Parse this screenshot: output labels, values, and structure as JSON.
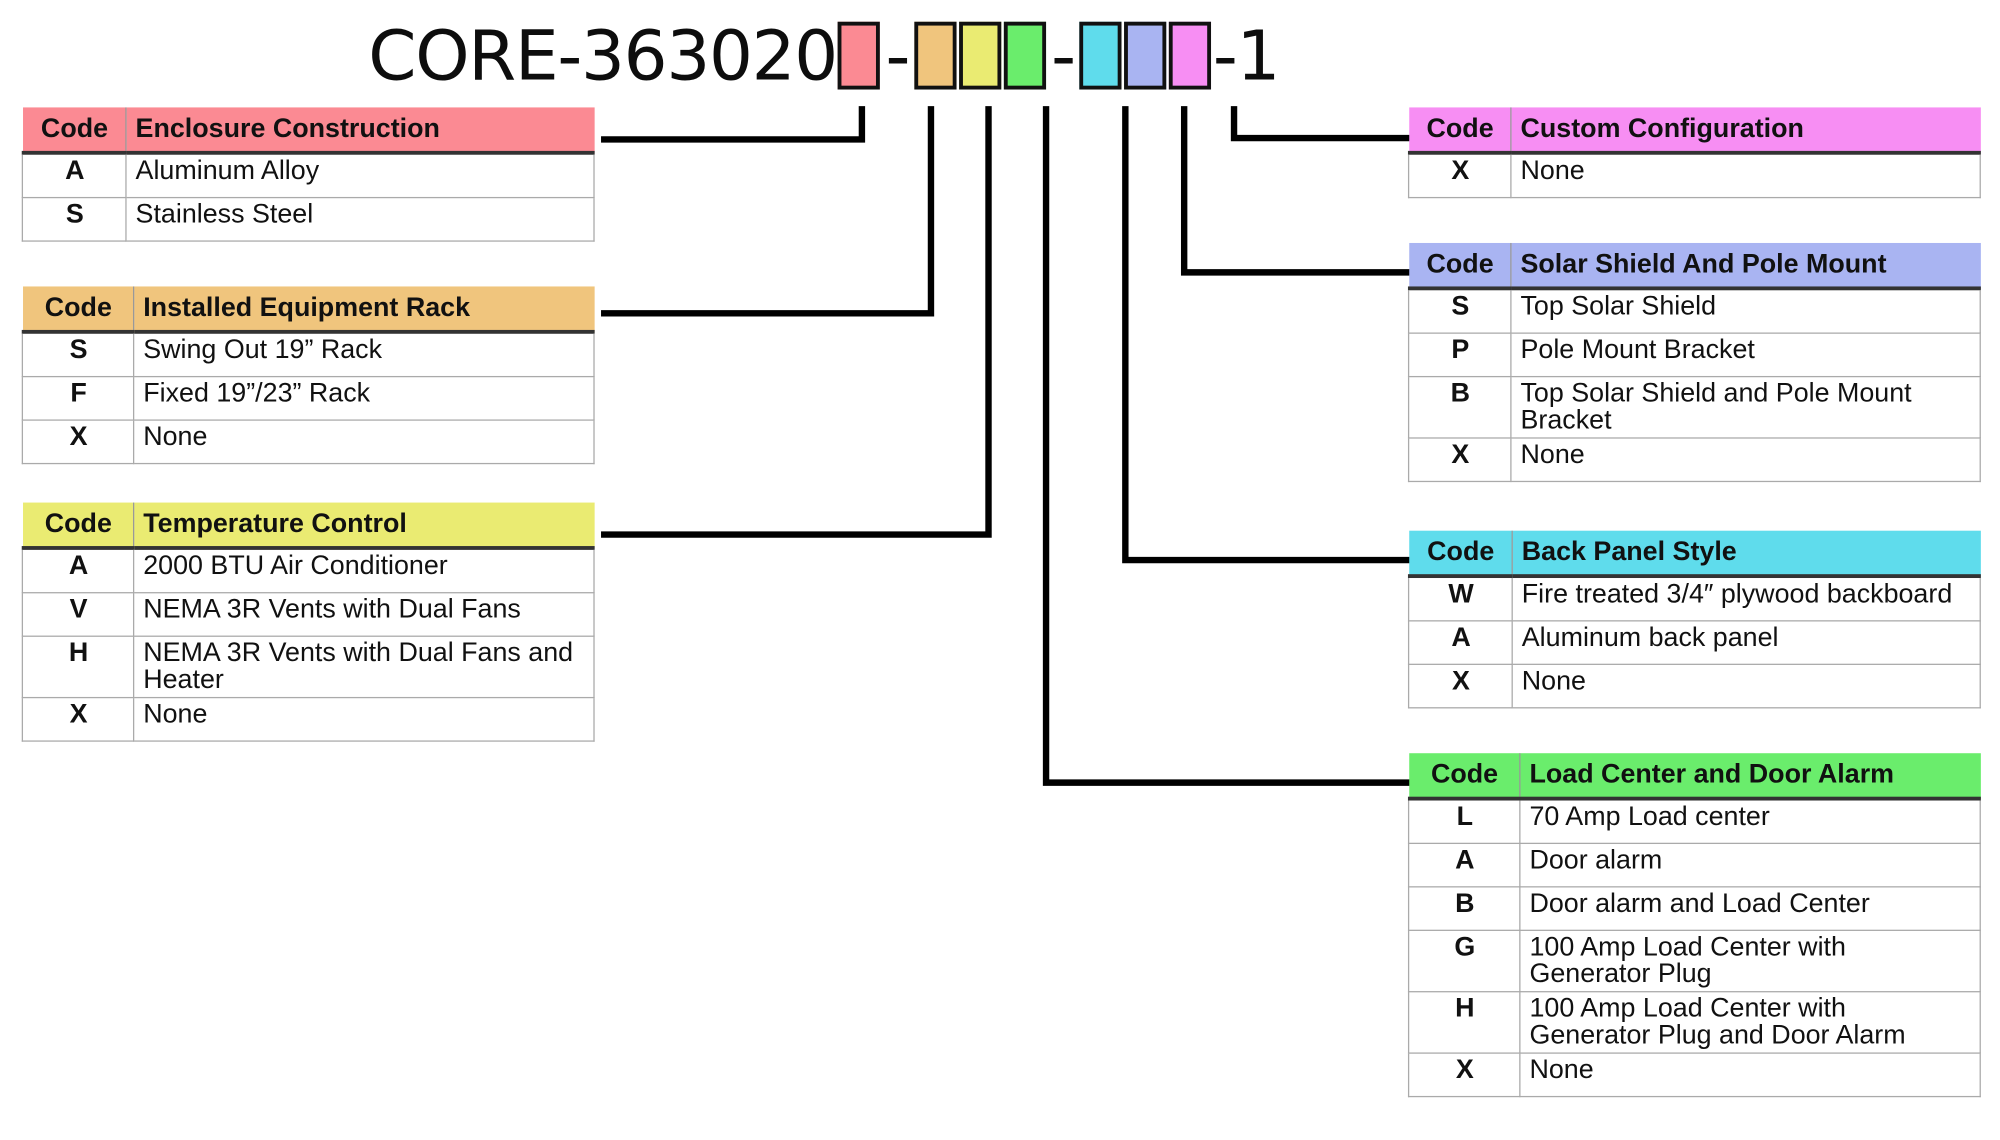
{
  "title": {
    "prefix": "CORE-363020",
    "dash": "-",
    "suffix": "-1"
  },
  "tables": [
    {
      "key": "enclosure",
      "color": "#fb8a93",
      "code_header": "Code",
      "title": "Enclosure Construction",
      "rows": [
        {
          "code": "A",
          "desc": "Aluminum Alloy"
        },
        {
          "code": "S",
          "desc": "Stainless Steel"
        }
      ]
    },
    {
      "key": "rack",
      "color": "#f0c57d",
      "code_header": "Code",
      "title": "Installed Equipment Rack",
      "rows": [
        {
          "code": "S",
          "desc": "Swing Out 19” Rack"
        },
        {
          "code": "F",
          "desc": "Fixed 19”/23” Rack"
        },
        {
          "code": "X",
          "desc": "None"
        }
      ]
    },
    {
      "key": "temp",
      "color": "#eaeb72",
      "code_header": "Code",
      "title": "Temperature Control",
      "rows": [
        {
          "code": "A",
          "desc": "2000 BTU Air Conditioner"
        },
        {
          "code": "V",
          "desc": "NEMA 3R Vents with Dual Fans"
        },
        {
          "code": "H",
          "desc": "NEMA 3R Vents with Dual Fans and Heater"
        },
        {
          "code": "X",
          "desc": "None"
        }
      ]
    },
    {
      "key": "custom",
      "color": "#f78ef3",
      "code_header": "Code",
      "title": "Custom Configuration",
      "rows": [
        {
          "code": "X",
          "desc": "None"
        }
      ]
    },
    {
      "key": "solar",
      "color": "#a9b4f2",
      "code_header": "Code",
      "title": "Solar Shield And Pole Mount",
      "rows": [
        {
          "code": "S",
          "desc": "Top Solar Shield"
        },
        {
          "code": "P",
          "desc": "Pole Mount Bracket"
        },
        {
          "code": "B",
          "desc": "Top Solar Shield and Pole Mount Bracket"
        },
        {
          "code": "X",
          "desc": "None"
        }
      ]
    },
    {
      "key": "backpanel",
      "color": "#5fdcec",
      "code_header": "Code",
      "title": "Back Panel Style",
      "rows": [
        {
          "code": "W",
          "desc": "Fire treated 3/4″ plywood backboard"
        },
        {
          "code": "A",
          "desc": "Aluminum back panel"
        },
        {
          "code": "X",
          "desc": "None"
        }
      ]
    },
    {
      "key": "load",
      "color": "#6aed6c",
      "code_header": "Code",
      "title": "Load Center and Door Alarm",
      "rows": [
        {
          "code": "L",
          "desc": "70 Amp Load center"
        },
        {
          "code": "A",
          "desc": "Door alarm"
        },
        {
          "code": "B",
          "desc": "Door alarm and Load Center"
        },
        {
          "code": "G",
          "desc": "100 Amp Load Center with Generator Plug"
        },
        {
          "code": "H",
          "desc": "100 Amp Load Center with Generator Plug and Door Alarm"
        },
        {
          "code": "X",
          "desc": "None"
        }
      ]
    }
  ]
}
